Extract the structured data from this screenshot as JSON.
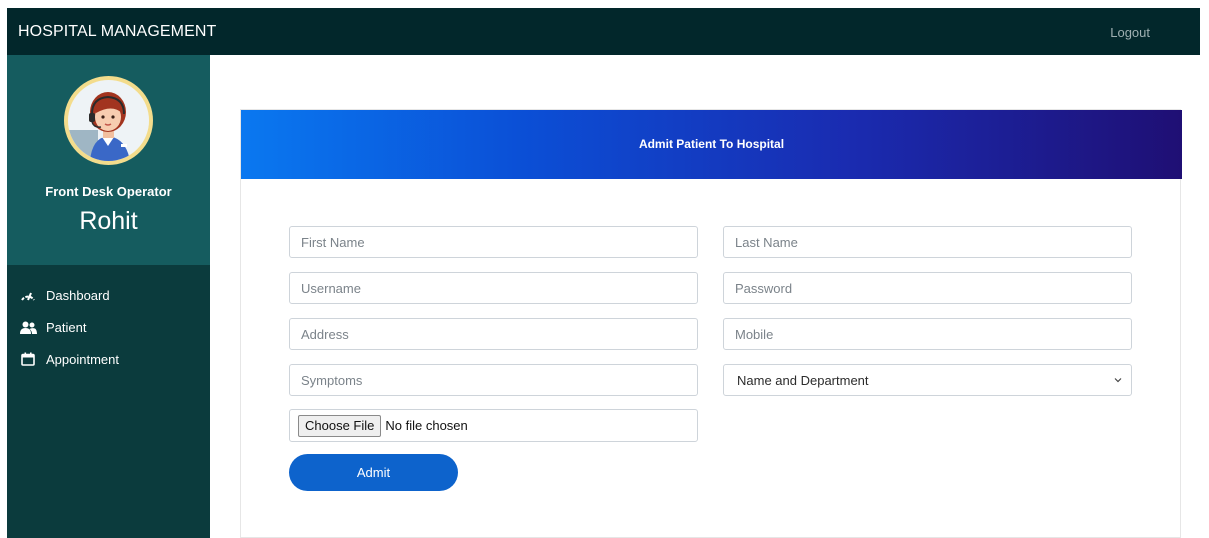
{
  "topbar": {
    "brand": "HOSPITAL MANAGEMENT",
    "logout_label": "Logout"
  },
  "sidebar": {
    "role": "Front Desk Operator",
    "user_name": "Rohit",
    "items": [
      {
        "label": "Dashboard",
        "icon": "speedometer-icon"
      },
      {
        "label": "Patient",
        "icon": "users-icon"
      },
      {
        "label": "Appointment",
        "icon": "calendar-icon"
      }
    ]
  },
  "form": {
    "title": "Admit Patient To Hospital",
    "first_name_placeholder": "First Name",
    "last_name_placeholder": "Last Name",
    "username_placeholder": "Username",
    "password_placeholder": "Password",
    "address_placeholder": "Address",
    "mobile_placeholder": "Mobile",
    "symptoms_placeholder": "Symptoms",
    "doctor_select_value": "Name and Department",
    "file_button_label": "Choose File",
    "file_status": "No file chosen",
    "submit_label": "Admit"
  },
  "colors": {
    "topbar": "#02272b",
    "sidebar": "#0b3b3d",
    "profile_panel": "#155c5f",
    "header_gradient_start": "#0a78f0",
    "header_gradient_end": "#1f0f74",
    "button": "#0d63cc"
  }
}
